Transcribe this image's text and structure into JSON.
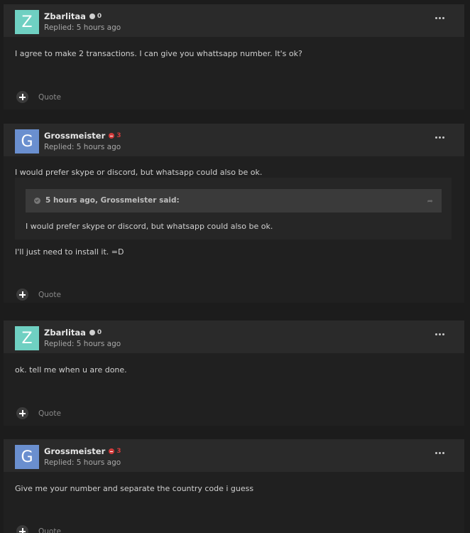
{
  "posts": [
    {
      "author": "Zbarlitaa",
      "avatar_letter": "Z",
      "avatar_color": "#6fd0c2",
      "reputation": "0",
      "rep_type": "neutral",
      "replied": "Replied: 5 hours ago",
      "body": "I agree to make 2 transactions. I can give you whattsapp number. It's ok?",
      "quote_label": "Quote"
    },
    {
      "author": "Grossmeister",
      "avatar_letter": "G",
      "avatar_color": "#6a8fcf",
      "reputation": "3",
      "rep_type": "negative",
      "replied": "Replied: 5 hours ago",
      "body": "I would prefer skype or discord, but whatsapp could also be ok.",
      "quote": {
        "citation": "5 hours ago, Grossmeister said:",
        "text": "I would prefer skype or discord, but whatsapp could also be ok."
      },
      "body_after": "I'll just need to install it. =D",
      "quote_label": "Quote"
    },
    {
      "author": "Zbarlitaa",
      "avatar_letter": "Z",
      "avatar_color": "#6fd0c2",
      "reputation": "0",
      "rep_type": "neutral",
      "replied": "Replied: 5 hours ago",
      "body": "ok. tell me when u are done.",
      "quote_label": "Quote"
    },
    {
      "author": "Grossmeister",
      "avatar_letter": "G",
      "avatar_color": "#6a8fcf",
      "reputation": "3",
      "rep_type": "negative",
      "replied": "Replied: 5 hours ago",
      "body": "Give me your number and separate the country code i guess",
      "quote_label": "Quote"
    }
  ]
}
